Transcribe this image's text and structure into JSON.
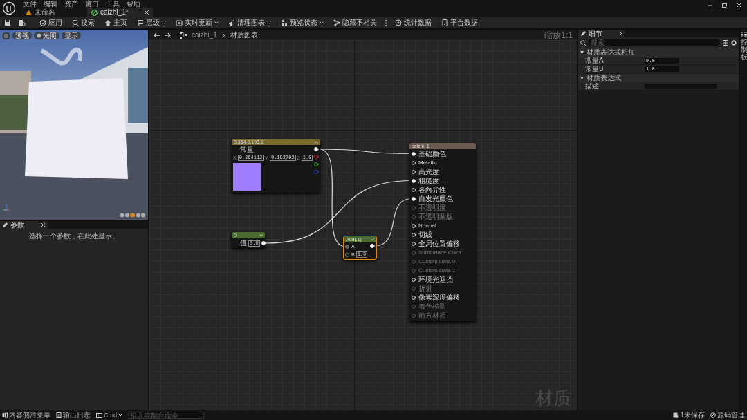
{
  "menu": [
    "文件",
    "编辑",
    "资产",
    "窗口",
    "工具",
    "帮助"
  ],
  "tabs": [
    {
      "label": "未命名",
      "selected": false
    },
    {
      "label": "caizhi_1*",
      "selected": true
    }
  ],
  "toolbar": [
    {
      "label": "应用",
      "dropdown": false
    },
    {
      "label": "搜索",
      "dropdown": false
    },
    {
      "label": "主页",
      "dropdown": false
    },
    {
      "label": "层级",
      "dropdown": true
    },
    {
      "label": "实时更新",
      "dropdown": true
    },
    {
      "label": "清理图表",
      "dropdown": true
    },
    {
      "label": "预览状态",
      "dropdown": true
    },
    {
      "label": "隐藏不相关",
      "dropdown": false
    },
    {
      "label": "统计数据",
      "dropdown": false
    },
    {
      "label": "平台数据",
      "dropdown": false
    }
  ],
  "viewport": {
    "buttons": [
      "透视",
      "光照",
      "显示"
    ]
  },
  "parameters_panel": {
    "tab": "参数",
    "message": "选择一个参数，在此处显示。"
  },
  "graph": {
    "breadcrumb": [
      "caizhi_1",
      "材质图表"
    ],
    "zoom": "缩放1:1",
    "watermark": "材质",
    "constant3": {
      "title": "0.364,0.193,1",
      "label": "常量",
      "fields": [
        {
          "axis": "X",
          "value": "0.364112"
        },
        {
          "axis": "Y",
          "value": "0.192792"
        },
        {
          "axis": "Z",
          "value": "1.0"
        }
      ],
      "color": "#a07cff"
    },
    "scalar": {
      "title": "0",
      "label": "值",
      "value": "0.0"
    },
    "add": {
      "title": "Add(,1)",
      "selected": true,
      "pins": [
        {
          "label": "A"
        },
        {
          "label": "B",
          "value": "1.0"
        }
      ]
    },
    "material": {
      "title": "caizhi_1",
      "pins": [
        {
          "label": "基础颜色",
          "enabled": true,
          "connected": true
        },
        {
          "label": "Metallic",
          "enabled": true,
          "connected": false
        },
        {
          "label": "高光度",
          "enabled": true,
          "connected": false
        },
        {
          "label": "粗糙度",
          "enabled": true,
          "connected": true
        },
        {
          "label": "各向异性",
          "enabled": true,
          "connected": false
        },
        {
          "label": "自发光颜色",
          "enabled": true,
          "connected": true
        },
        {
          "label": "不透明度",
          "enabled": false,
          "connected": false
        },
        {
          "label": "不透明蒙版",
          "enabled": false,
          "connected": false
        },
        {
          "label": "Normal",
          "enabled": true,
          "connected": false
        },
        {
          "label": "切线",
          "enabled": true,
          "connected": false
        },
        {
          "label": "全局位置偏移",
          "enabled": true,
          "connected": false
        },
        {
          "label": "Subsurface Color",
          "enabled": false,
          "connected": false
        },
        {
          "label": "Custom Data 0",
          "enabled": false,
          "connected": false
        },
        {
          "label": "Custom Data 1",
          "enabled": false,
          "connected": false
        },
        {
          "label": "环境光遮挡",
          "enabled": true,
          "connected": false
        },
        {
          "label": "折射",
          "enabled": false,
          "connected": false
        },
        {
          "label": "像素深度偏移",
          "enabled": true,
          "connected": false
        },
        {
          "label": "着色模型",
          "enabled": false,
          "connected": false
        },
        {
          "label": "前方材质",
          "enabled": false,
          "connected": false
        }
      ]
    }
  },
  "details": {
    "tab": "细节",
    "search_placeholder": "搜索",
    "sections": [
      {
        "title": "材质表达式相加",
        "expanded": true,
        "rows": [
          {
            "label": "常量A",
            "value": "0.0"
          },
          {
            "label": "常量B",
            "value": "1.0"
          }
        ]
      },
      {
        "title": "材质表达式",
        "expanded": true,
        "rows": [
          {
            "label": "描述",
            "value": ""
          }
        ]
      }
    ]
  },
  "side_tab": "控制板",
  "status_bar": {
    "content_drawer": "内容侧滑菜单",
    "output_log": "输出日志",
    "cmd": "Cmd",
    "console_placeholder": "输入控制台命令",
    "unsaved": "1未保存",
    "source_control": "源码管理"
  }
}
